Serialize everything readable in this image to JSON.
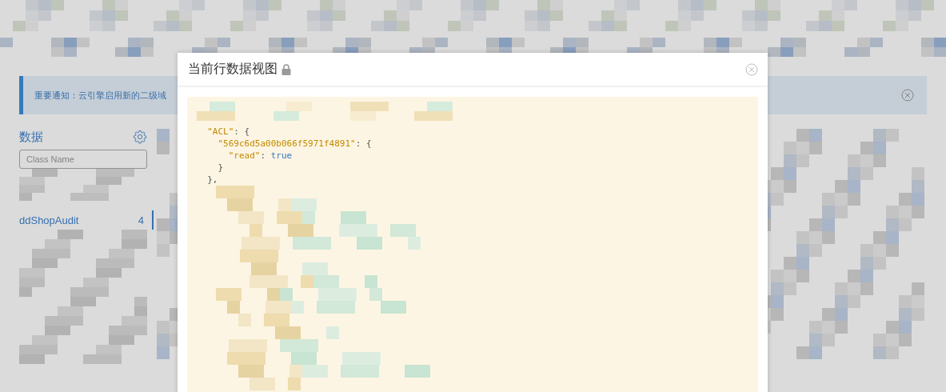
{
  "notice": {
    "text": "重要通知：云引擎启用新的二级域"
  },
  "sidebar": {
    "title": "数据",
    "search": {
      "placeholder": "Class Name"
    },
    "classes": [
      {
        "name": "ddShopAudit",
        "count": "4",
        "selected": true
      }
    ]
  },
  "dialog": {
    "title": "当前行数据视图",
    "code_lines": [
      [
        {
          "kind": "key",
          "text": "  \"ACL\""
        },
        {
          "kind": "punct",
          "text": ": {"
        }
      ],
      [
        {
          "kind": "key",
          "text": "    \"569c6d5a00b066f5971f4891\""
        },
        {
          "kind": "punct",
          "text": ": {"
        }
      ],
      [
        {
          "kind": "key",
          "text": "      \"read\""
        },
        {
          "kind": "punct",
          "text": ": "
        },
        {
          "kind": "bool",
          "text": "true"
        }
      ],
      [
        {
          "kind": "punct",
          "text": "    }"
        }
      ],
      [
        {
          "kind": "punct",
          "text": "  },"
        }
      ]
    ]
  }
}
